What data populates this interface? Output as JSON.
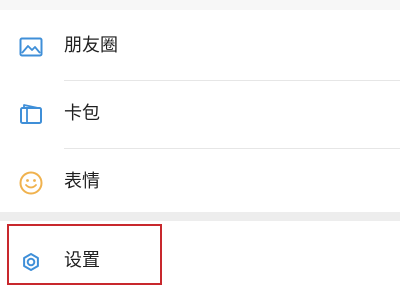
{
  "menu": {
    "items": [
      {
        "label": "朋友圈",
        "icon": "image-icon"
      },
      {
        "label": "卡包",
        "icon": "card-wallet-icon"
      },
      {
        "label": "表情",
        "icon": "smiley-face-icon"
      }
    ],
    "settings": {
      "label": "设置",
      "icon": "gear-icon"
    }
  },
  "colors": {
    "icon_blue": "#3f8fd8",
    "emoji_yellow": "#f0b24e",
    "highlight_red": "#c8282d"
  }
}
